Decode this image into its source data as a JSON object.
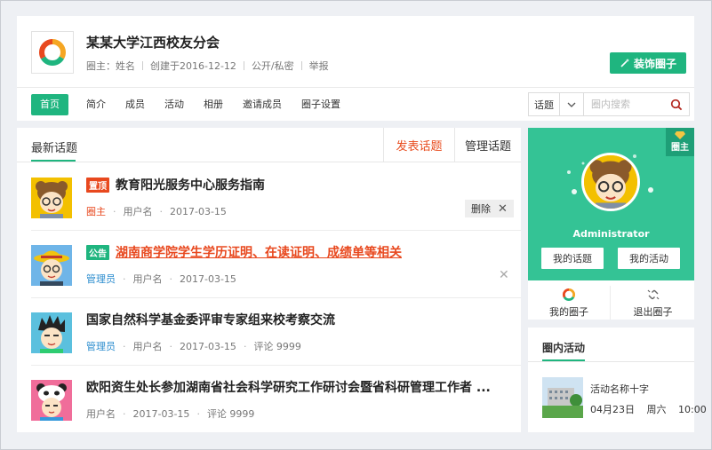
{
  "header": {
    "circle_name": "某某大学江西校友分会",
    "owner_label": "圈主：",
    "owner_name": "姓名",
    "created": "创建于2016-12-12",
    "visibility": "公开/私密",
    "report": "举报",
    "decorate_label": "装饰圈子"
  },
  "nav": {
    "items": [
      {
        "label": "首页",
        "active": true
      },
      {
        "label": "简介"
      },
      {
        "label": "成员"
      },
      {
        "label": "活动"
      },
      {
        "label": "相册"
      },
      {
        "label": "邀请成员"
      },
      {
        "label": "圈子设置"
      }
    ]
  },
  "search": {
    "type_label": "话题",
    "placeholder": "圈内搜索"
  },
  "topics": {
    "tab_latest": "最新话题",
    "tab_post": "发表话题",
    "tab_manage": "管理话题",
    "items": [
      {
        "badge": "置顶",
        "title": "教育阳光服务中心服务指南",
        "role": "圈主",
        "user": "用户名",
        "date": "2017-03-15",
        "action": "删除"
      },
      {
        "badge": "公告",
        "title": "湖南商学院学生学历证明、在读证明、成绩单等相关",
        "role": "管理员",
        "user": "用户名",
        "date": "2017-03-15"
      },
      {
        "title": "国家自然科学基金委评审专家组来校考察交流",
        "role": "管理员",
        "user": "用户名",
        "date": "2017-03-15",
        "comments": "评论 9999"
      },
      {
        "title": "欧阳资生处长参加湖南省社会科学研究工作研讨会暨省科研管理工作者 ...",
        "user": "用户名",
        "date": "2017-03-15",
        "comments": "评论 9999"
      }
    ]
  },
  "profile": {
    "owner_badge": "圈主",
    "name": "Administrator",
    "my_topics": "我的话题",
    "my_activities": "我的活动",
    "my_circle": "我的圈子",
    "exit_circle": "退出圈子"
  },
  "activities": {
    "title": "圈内活动",
    "item": {
      "name": "活动名称十字",
      "date": "04月23日",
      "weekday": "周六",
      "time": "10:00"
    }
  },
  "colors": {
    "accent": "#1fb57f",
    "highlight": "#e8481e",
    "admin": "#2a8cce"
  }
}
